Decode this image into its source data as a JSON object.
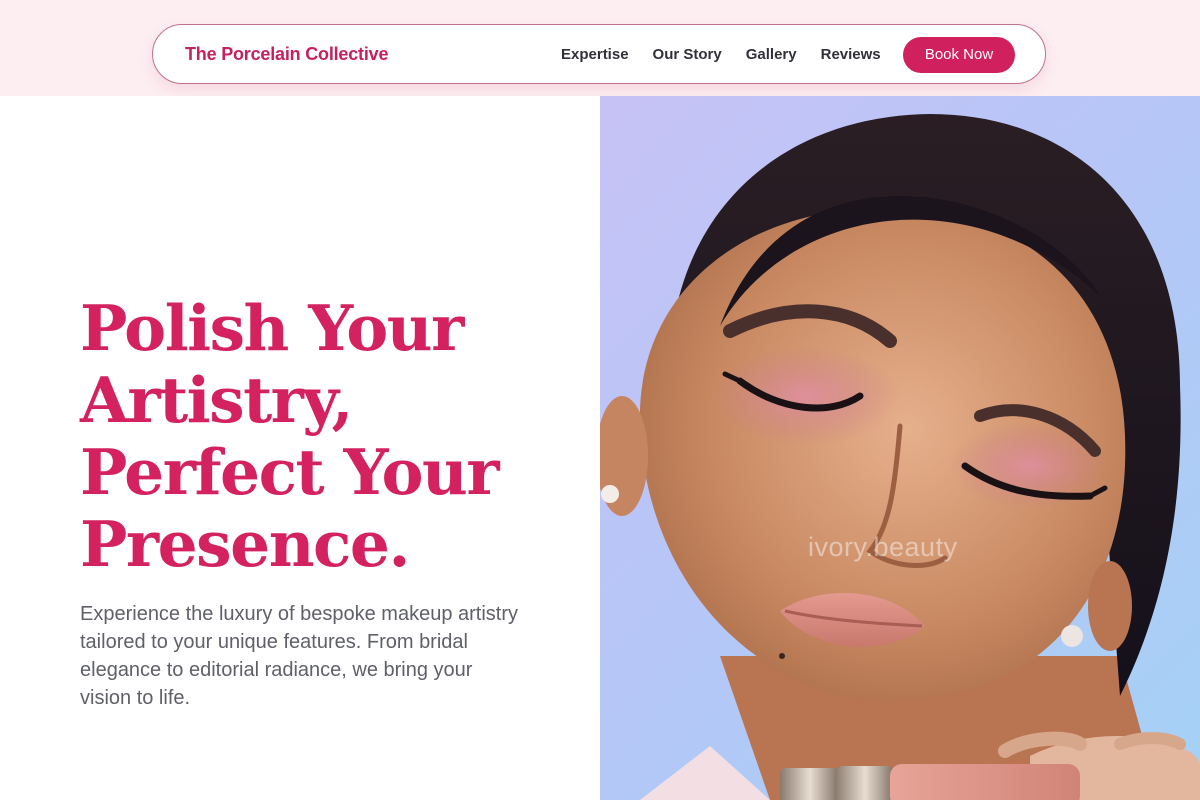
{
  "nav": {
    "brand": "The Porcelain Collective",
    "links": [
      "Expertise",
      "Our Story",
      "Gallery",
      "Reviews"
    ],
    "cta": "Book Now"
  },
  "hero": {
    "headline_lines": [
      "Polish Your",
      "Artistry,",
      "Perfect Your",
      "Presence."
    ],
    "subtext": "Experience the luxury of bespoke makeup artistry tailored to your unique features. From bridal elegance to editorial radiance, we bring your vision to life.",
    "image_watermark": "ivory.beauty"
  },
  "colors": {
    "accent": "#d3225f",
    "top_band": "#fdeef2",
    "nav_border": "#c2708f",
    "body_text": "#5f6068"
  },
  "icons": {
    "hero_image": "makeup-portrait-photo"
  }
}
